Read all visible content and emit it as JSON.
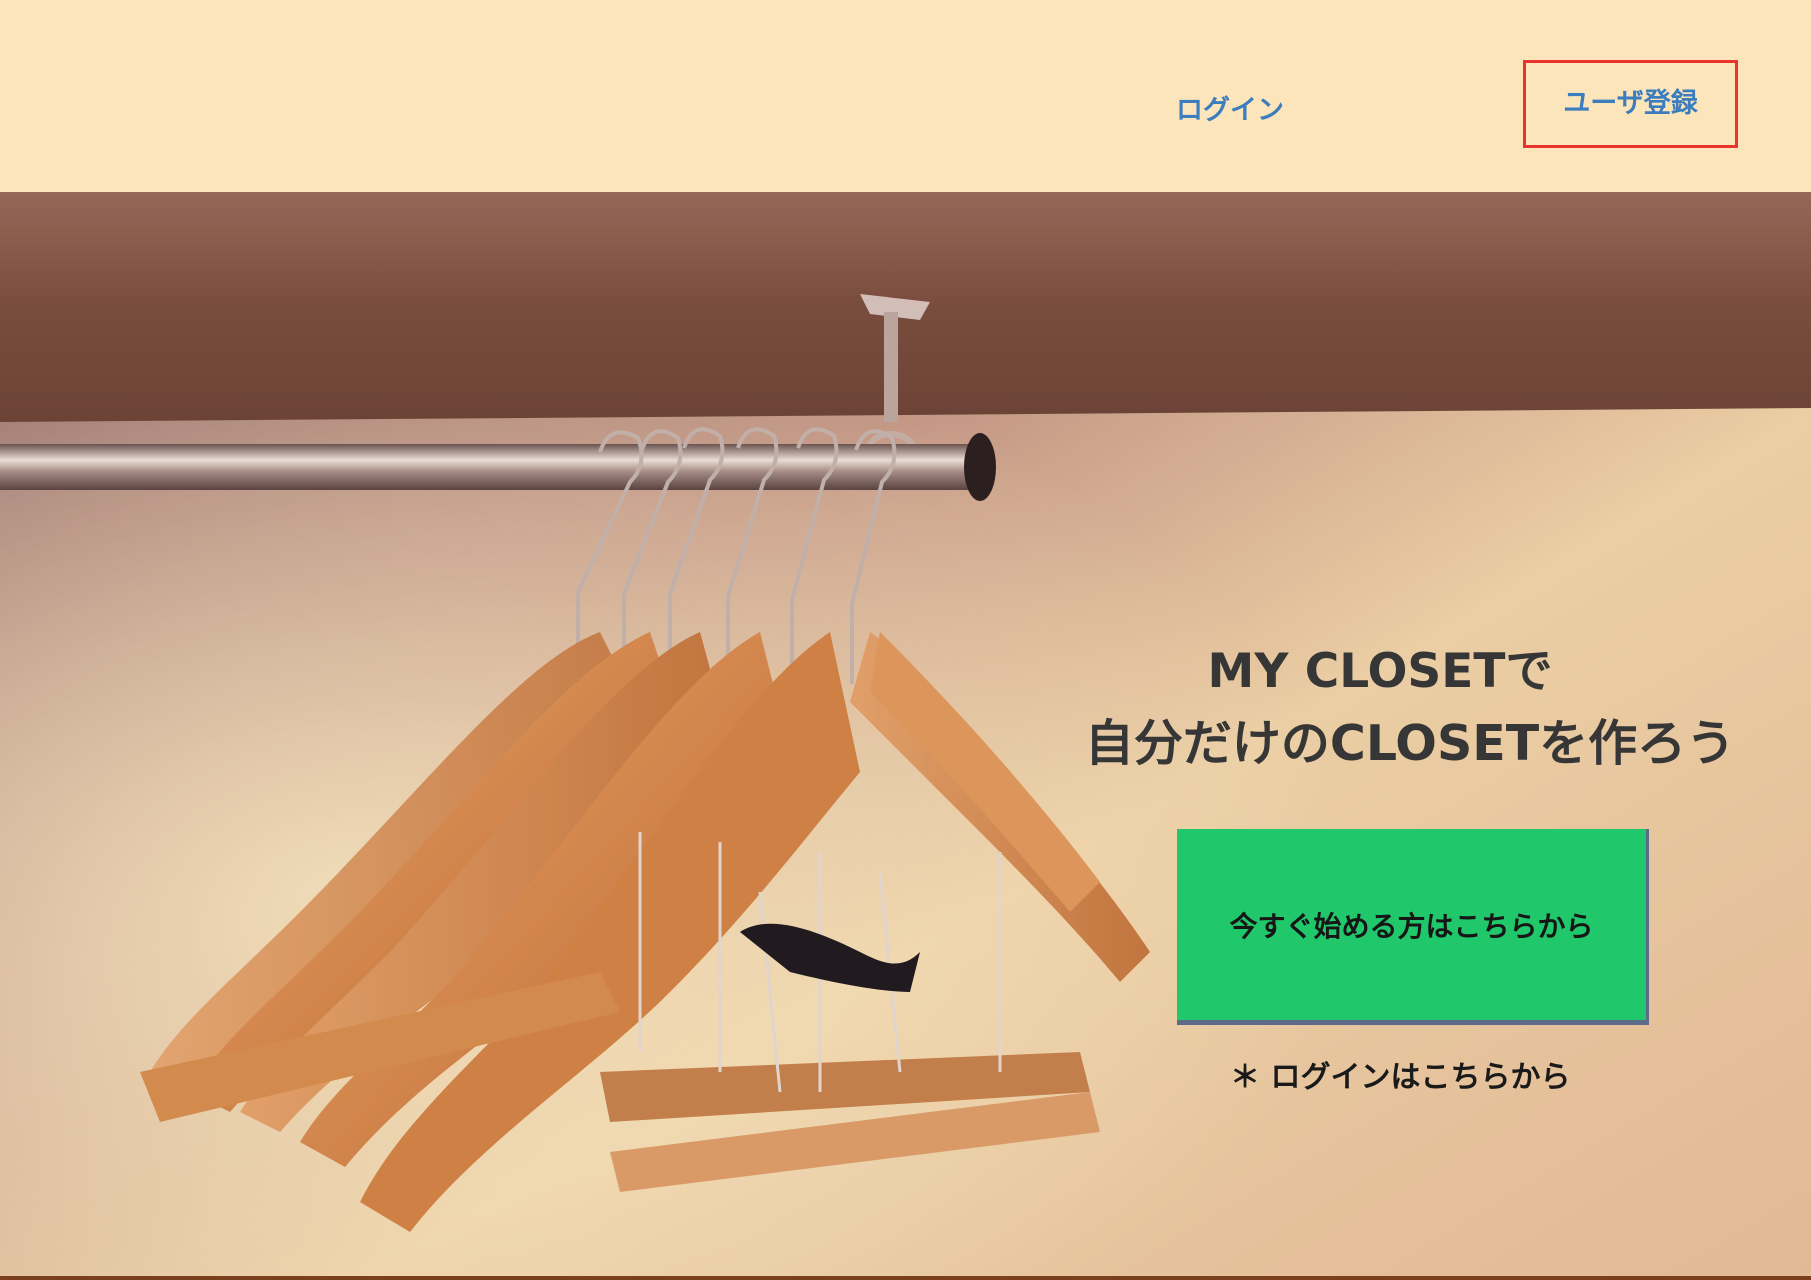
{
  "header": {
    "login_label": "ログイン",
    "register_label": "ユーザ登録"
  },
  "hero": {
    "title_line1": "MY CLOSETで",
    "title_line2": "自分だけのCLOSETを作ろう",
    "cta_label": "今すぐ始める方はこちらから",
    "login_note": "＊ ログインはこちらから",
    "image": "closet-hangers-photo"
  },
  "colors": {
    "header_bg": "#fde5bb",
    "link": "#3c7dbe",
    "register_highlight": "#e8342c",
    "cta_bg": "#20c86b"
  }
}
